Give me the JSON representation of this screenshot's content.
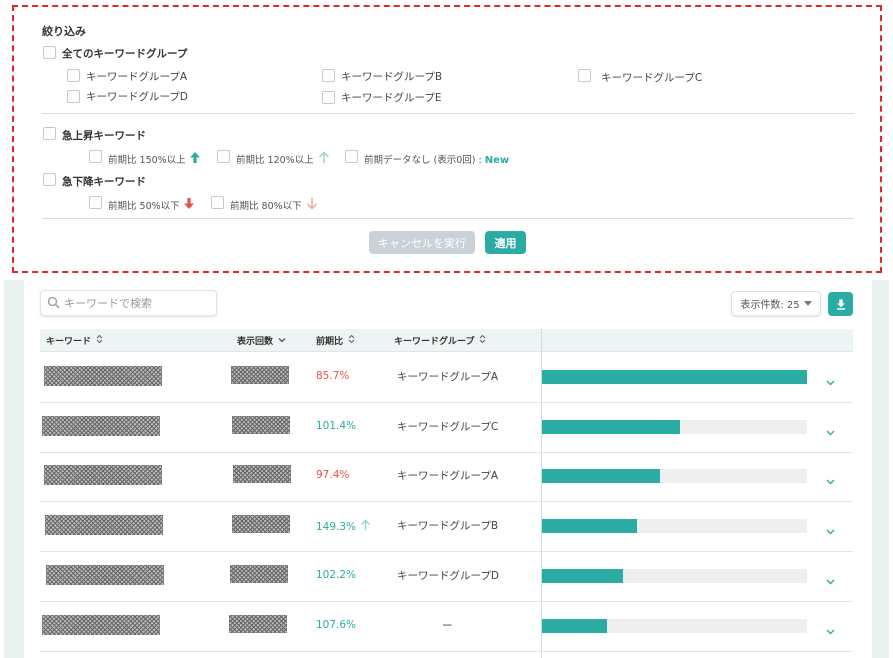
{
  "filter": {
    "title": "絞り込み",
    "all_groups": "全てのキーワードグループ",
    "groups": [
      "キーワードグループA",
      "キーワードグループB",
      "キーワードグループC",
      "キーワードグループD",
      "キーワードグループE"
    ],
    "rising": {
      "title": "急上昇キーワード",
      "opt1": "前期比 150%以上",
      "opt2": "前期比 120%以上",
      "opt3": "前期データなし (表示0回) :",
      "new_tag": "New"
    },
    "falling": {
      "title": "急下降キーワード",
      "opt1": "前期比 50%以下",
      "opt2": "前期比 80%以下"
    },
    "cancel_label": "キャンセルを実行",
    "apply_label": "適用"
  },
  "toolbar": {
    "search_placeholder": "キーワードで検索",
    "per_page_label": "表示件数: 25"
  },
  "table": {
    "headers": {
      "keyword": "キーワード",
      "impressions": "表示回数",
      "ratio": "前期比",
      "group": "キーワードグループ"
    },
    "rows": [
      {
        "ratio": "85.7%",
        "trend": "down",
        "arrow": false,
        "group": "キーワードグループA",
        "bar": 1.0
      },
      {
        "ratio": "101.4%",
        "trend": "up",
        "arrow": false,
        "group": "キーワードグループC",
        "bar": 0.52
      },
      {
        "ratio": "97.4%",
        "trend": "down",
        "arrow": false,
        "group": "キーワードグループA",
        "bar": 0.445
      },
      {
        "ratio": "149.3%",
        "trend": "up",
        "arrow": true,
        "group": "キーワードグループB",
        "bar": 0.36
      },
      {
        "ratio": "102.2%",
        "trend": "up",
        "arrow": false,
        "group": "キーワードグループD",
        "bar": 0.305
      },
      {
        "ratio": "107.6%",
        "trend": "up",
        "arrow": false,
        "group": "ー",
        "bar": 0.245
      }
    ]
  },
  "colors": {
    "accent": "#2aaba4",
    "down": "#e8504a",
    "down_light": "#f0a09c",
    "up_light": "#8fd3cf"
  }
}
